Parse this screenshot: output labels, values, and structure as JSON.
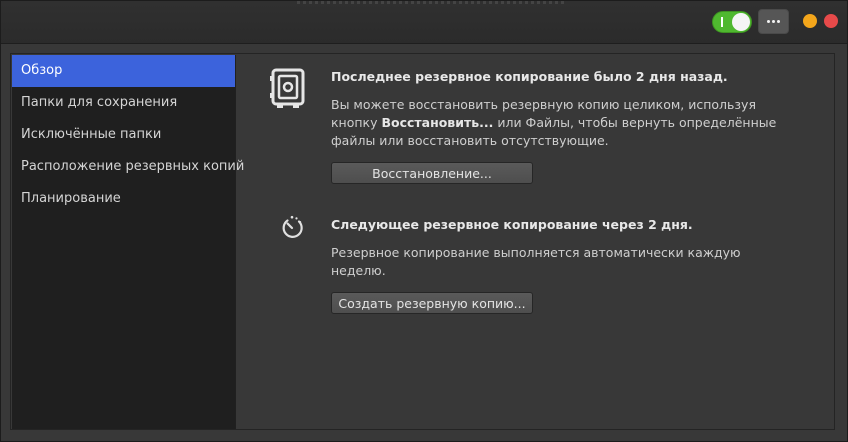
{
  "titlebar": {
    "toggle": {
      "state": "on",
      "mark": "I",
      "color": "#4fb82f"
    },
    "menu_icon": "ellipsis-icon",
    "minimize_color": "#f4a61b",
    "close_color": "#e74a4a"
  },
  "sidebar": {
    "active_color": "#3c63dc",
    "items": [
      {
        "label": "Обзор",
        "active": true
      },
      {
        "label": "Папки для сохранения",
        "active": false
      },
      {
        "label": "Исключённые папки",
        "active": false
      },
      {
        "label": "Расположение резервных копий",
        "active": false
      },
      {
        "label": "Планирование",
        "active": false
      }
    ]
  },
  "overview": {
    "restore": {
      "icon": "safe-icon",
      "heading": "Последнее резервное копирование было 2 дня назад.",
      "desc_line1": "Вы можете восстановить резервную копию целиком, используя",
      "desc_line2_pre": "кнопку ",
      "desc_line2_bold": "Восстановить...",
      "desc_line2_post": " или Файлы, чтобы вернуть определённые",
      "desc_line3": "файлы или восстановить отсутствующие.",
      "button": "Восстановление..."
    },
    "backup": {
      "icon": "timer-icon",
      "heading": "Следующее резервное копирование через 2 дня.",
      "desc": "Резервное копирование выполняется автоматически каждую неделю.",
      "button": "Создать резервную копию..."
    }
  }
}
